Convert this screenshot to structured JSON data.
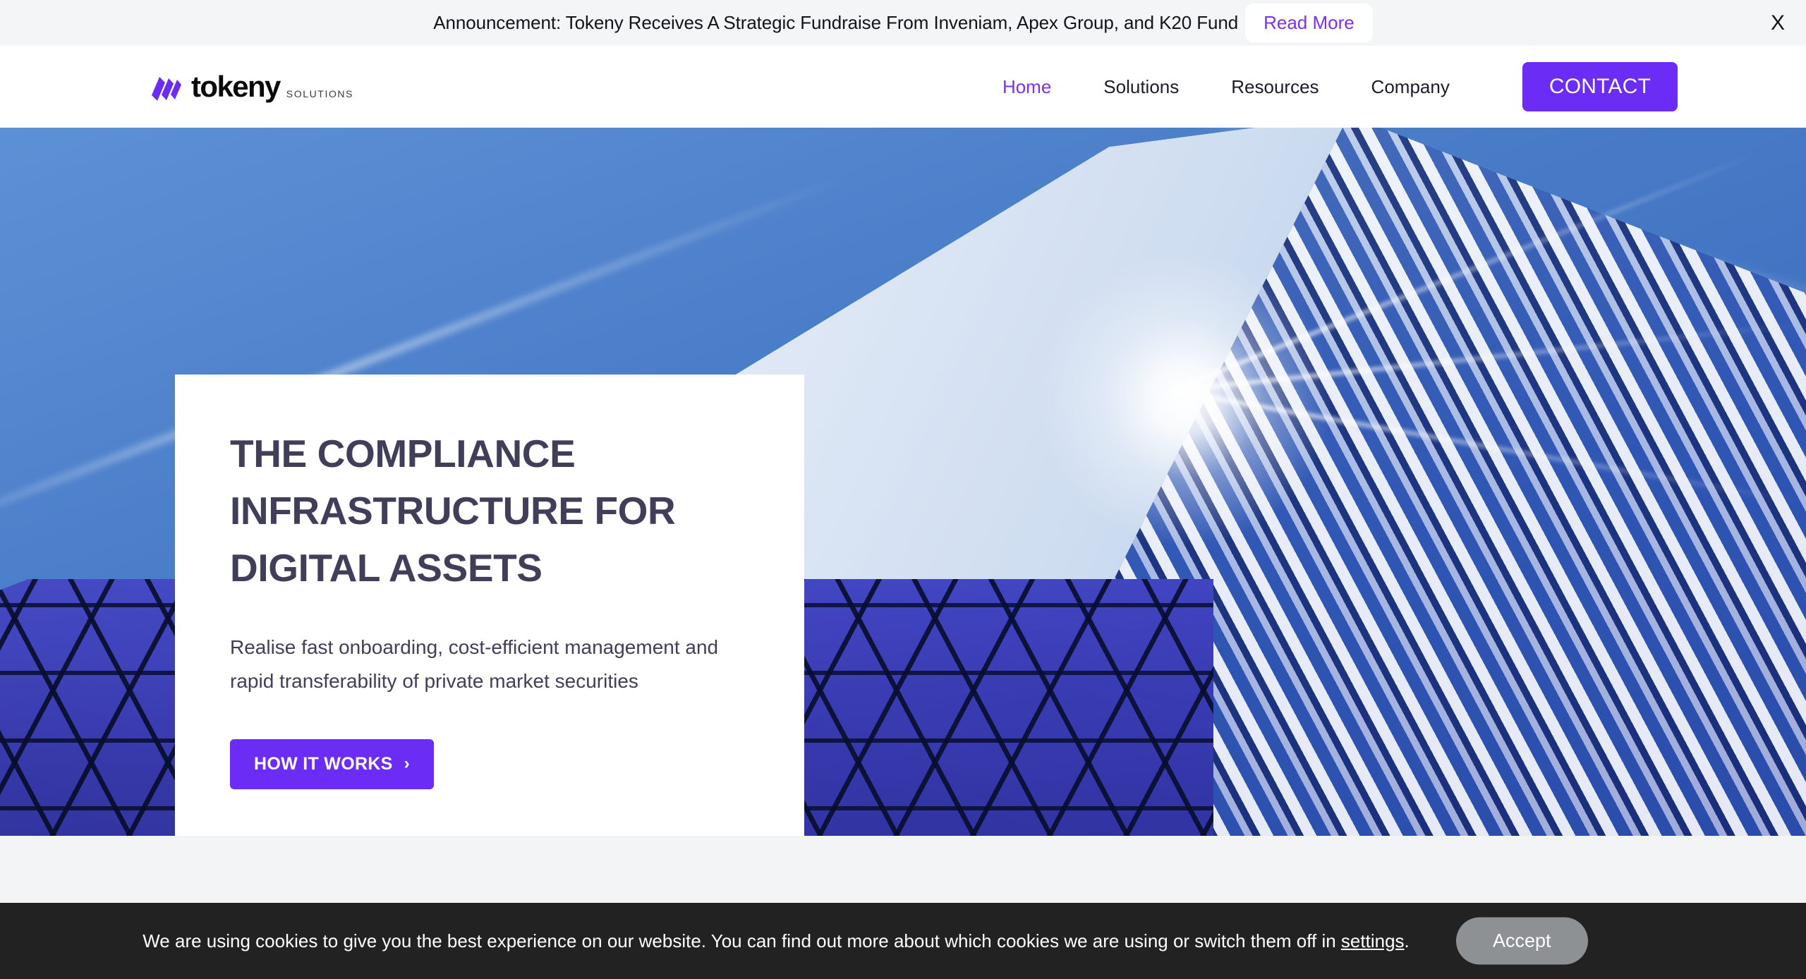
{
  "announcement": {
    "text": "Announcement: Tokeny Receives A Strategic Fundraise From Inveniam, Apex Group, and K20 Fund",
    "read_more_label": "Read More",
    "close_label": "X",
    "link_color": "#7b2ff7",
    "background": "#f4f5f7"
  },
  "header": {
    "logo": {
      "word": "tokeny",
      "subtitle": "SOLUTIONS",
      "mark_color": "#6b2cf5"
    },
    "nav": [
      {
        "label": "Home",
        "active": true
      },
      {
        "label": "Solutions",
        "active": false
      },
      {
        "label": "Resources",
        "active": false
      },
      {
        "label": "Company",
        "active": false
      }
    ],
    "contact_label": "CONTACT",
    "contact_color": "#6b2cf5"
  },
  "hero": {
    "title": "THE COMPLIANCE INFRASTRUCTURE FOR DIGITAL ASSETS",
    "subtitle": "Realise fast onboarding, cost-efficient management and rapid transferability of private market securities",
    "cta_label": "HOW IT WORKS",
    "cta_chevron": "›",
    "title_color": "#403e59",
    "cta_color": "#6b2cf5",
    "background_image": "glass-skyscraper-blue-sky"
  },
  "cookie_banner": {
    "text_before_link": "We are using cookies to give you the best experience on our website. You can find out more about which cookies we are using or switch them off in ",
    "link_label": "settings",
    "text_after_link": ".",
    "accept_label": "Accept",
    "background": "#222222",
    "accept_color": "#8e9194"
  }
}
